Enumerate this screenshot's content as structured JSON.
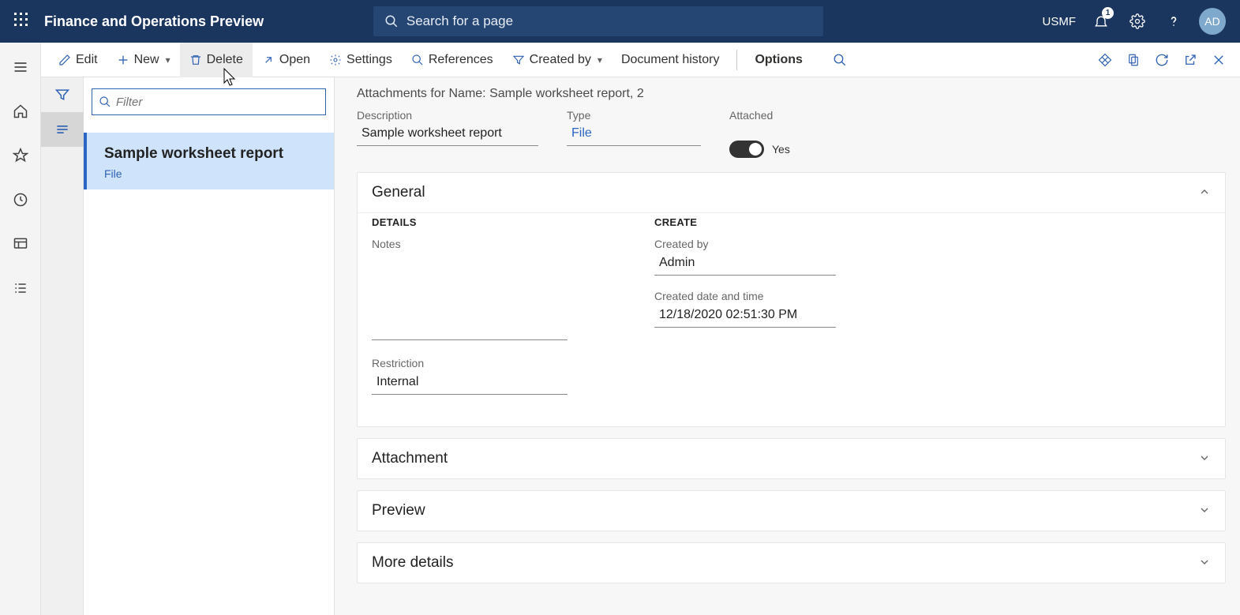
{
  "header": {
    "app_title": "Finance and Operations Preview",
    "search_placeholder": "Search for a page",
    "company": "USMF",
    "notif_count": "1",
    "avatar_initials": "AD"
  },
  "toolbar": {
    "edit": "Edit",
    "new": "New",
    "delete": "Delete",
    "open": "Open",
    "settings": "Settings",
    "references": "References",
    "created_by": "Created by",
    "document_history": "Document history",
    "options": "Options"
  },
  "list": {
    "filter_placeholder": "Filter",
    "item_title": "Sample worksheet report",
    "item_sub": "File"
  },
  "detail": {
    "crumb": "Attachments for Name: Sample worksheet report, 2",
    "description_label": "Description",
    "description_value": "Sample worksheet report",
    "type_label": "Type",
    "type_value": "File",
    "attached_label": "Attached",
    "attached_value": "Yes"
  },
  "general": {
    "title": "General",
    "details_title": "DETAILS",
    "notes_label": "Notes",
    "restriction_label": "Restriction",
    "restriction_value": "Internal",
    "create_title": "CREATE",
    "created_by_label": "Created by",
    "created_by_value": "Admin",
    "created_dt_label": "Created date and time",
    "created_dt_value": "12/18/2020 02:51:30 PM"
  },
  "sections": {
    "attachment": "Attachment",
    "preview": "Preview",
    "more": "More details"
  }
}
